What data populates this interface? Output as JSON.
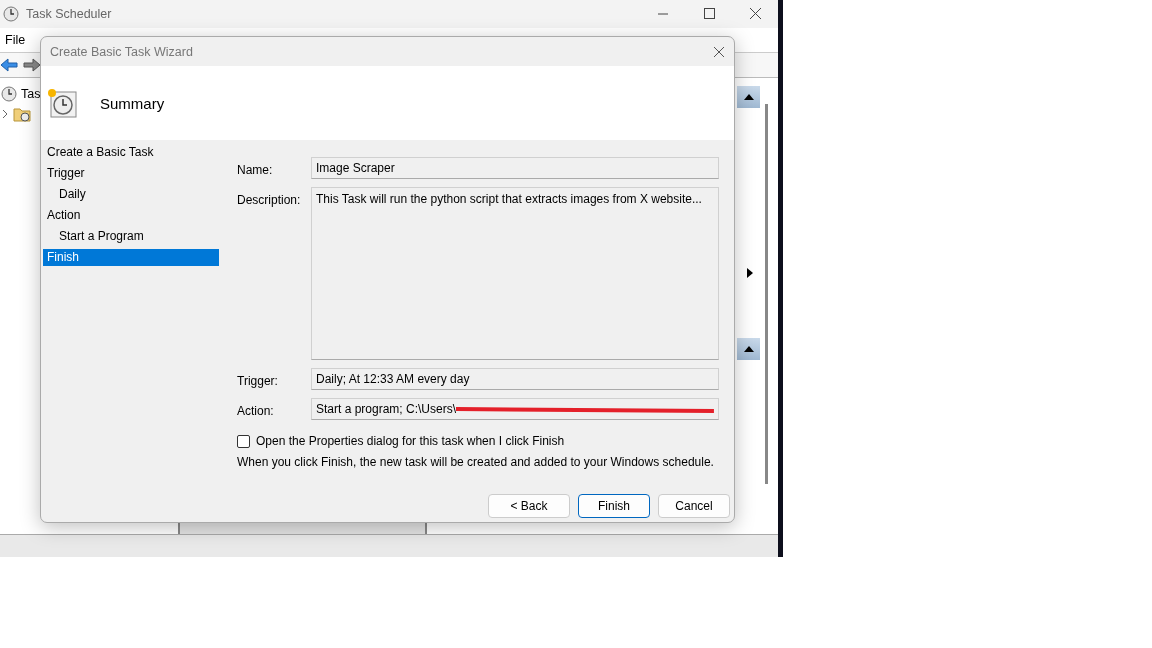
{
  "main_window": {
    "title": "Task Scheduler",
    "menu": [
      "File"
    ],
    "tree": [
      {
        "label": "Tas"
      }
    ]
  },
  "dialog": {
    "title": "Create Basic Task Wizard",
    "heading": "Summary",
    "steps": [
      {
        "label": "Create a Basic Task",
        "selected": false
      },
      {
        "label": "Trigger",
        "selected": false,
        "children": [
          {
            "label": "Daily",
            "selected": false
          }
        ]
      },
      {
        "label": "Action",
        "selected": false,
        "children": [
          {
            "label": "Start a Program",
            "selected": false
          }
        ]
      },
      {
        "label": "Finish",
        "selected": true
      }
    ],
    "fields": [
      {
        "label": "Name:",
        "value": "Image Scraper",
        "kind": "line"
      },
      {
        "label": "Description:",
        "value": "This Task will run the python script that extracts images from X website...",
        "kind": "area"
      },
      {
        "label": "Trigger:",
        "value": "Daily; At 12:33 AM every day",
        "kind": "line"
      },
      {
        "label": "Action:",
        "value": "Start a program; C:\\Users\\",
        "kind": "redacted"
      }
    ],
    "checkbox": {
      "label": "Open the Properties dialog for this task when I click Finish",
      "checked": false
    },
    "note": "When you click Finish, the new task will be created and added to your Windows schedule.",
    "buttons": [
      {
        "label": "< Back",
        "default": false
      },
      {
        "label": "Finish",
        "default": true
      },
      {
        "label": "Cancel",
        "default": false
      }
    ]
  }
}
